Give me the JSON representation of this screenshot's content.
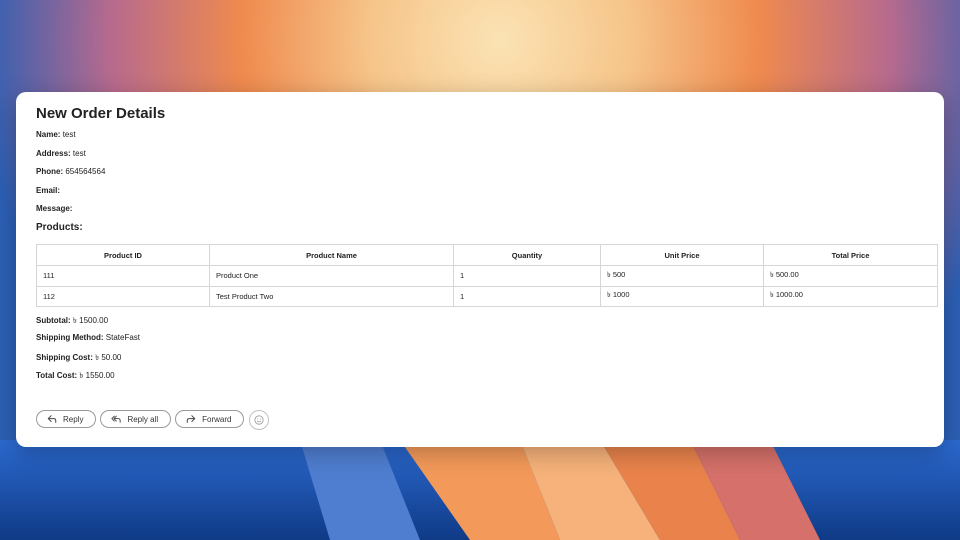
{
  "email": {
    "title": "New Order Details",
    "fields": [
      {
        "label": "Name:",
        "value": "test"
      },
      {
        "label": "Address:",
        "value": "test"
      },
      {
        "label": "Phone:",
        "value": "654564564"
      },
      {
        "label": "Email:",
        "value": ""
      },
      {
        "label": "Message:",
        "value": ""
      }
    ],
    "products_heading": "Products:",
    "table": {
      "headers": [
        "Product ID",
        "Product Name",
        "Quantity",
        "Unit Price",
        "Total Price"
      ],
      "rows": [
        [
          "111",
          "Product One",
          "1",
          "৳ 500",
          "৳ 500.00"
        ],
        [
          "112",
          "Test Product Two",
          "1",
          "৳ 1000",
          "৳ 1000.00"
        ]
      ]
    },
    "summary": [
      {
        "label": "Subtotal:",
        "value": "৳ 1500.00"
      },
      {
        "label": "Shipping Method:",
        "value": "StateFast"
      },
      {
        "label": "Shipping Cost:",
        "value": "৳ 50.00"
      },
      {
        "label": "Total Cost:",
        "value": "৳ 1550.00"
      }
    ]
  },
  "actions": {
    "reply": "Reply",
    "reply_all": "Reply all",
    "forward": "Forward"
  },
  "icons": {
    "reply": "reply-icon",
    "reply_all": "reply-all-icon",
    "forward": "forward-icon",
    "emoji": "emoji-icon"
  },
  "colors": {
    "wallpaper_blue": "#1c5fb8",
    "wallpaper_orange": "#f08a4b",
    "wallpaper_cream": "#f6d9a6",
    "card": "#ffffff"
  }
}
